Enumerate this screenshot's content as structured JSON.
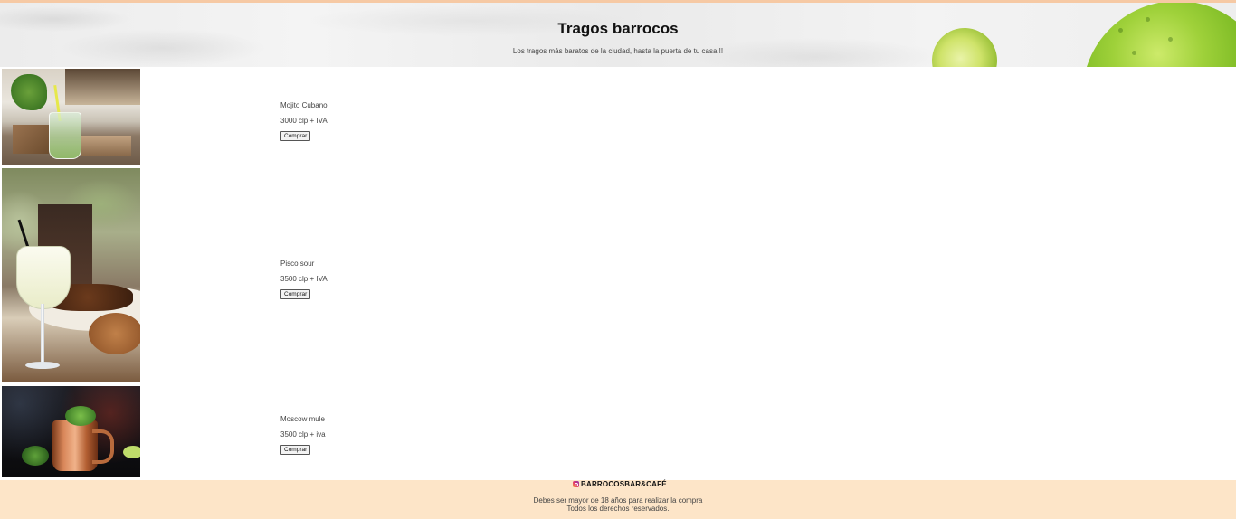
{
  "header": {
    "title": "Tragos barrocos",
    "subtitle": "Los tragos más baratos de la ciudad, hasta la puerta de tu casa!!!"
  },
  "products": [
    {
      "name": "Mojito Cubano",
      "price": "3000 clp + IVA",
      "button": "Comprar",
      "image": "mojito-photo"
    },
    {
      "name": "Pisco sour",
      "price": "3500 clp + IVA",
      "button": "Comprar",
      "image": "pisco-sour-photo"
    },
    {
      "name": "Moscow mule",
      "price": "3500 clp + iva",
      "button": "Comprar",
      "image": "moscow-mule-photo"
    }
  ],
  "footer": {
    "instagram_icon": "instagram-icon",
    "instagram_handle": "BARROCOSBAR&CAFÉ",
    "age_notice": "Debes ser mayor de 18 años para realizar la compra",
    "rights": "Todos los derechos reservados."
  },
  "colors": {
    "footer_bg": "#fde5c8",
    "page_bg": "#ffffff"
  }
}
